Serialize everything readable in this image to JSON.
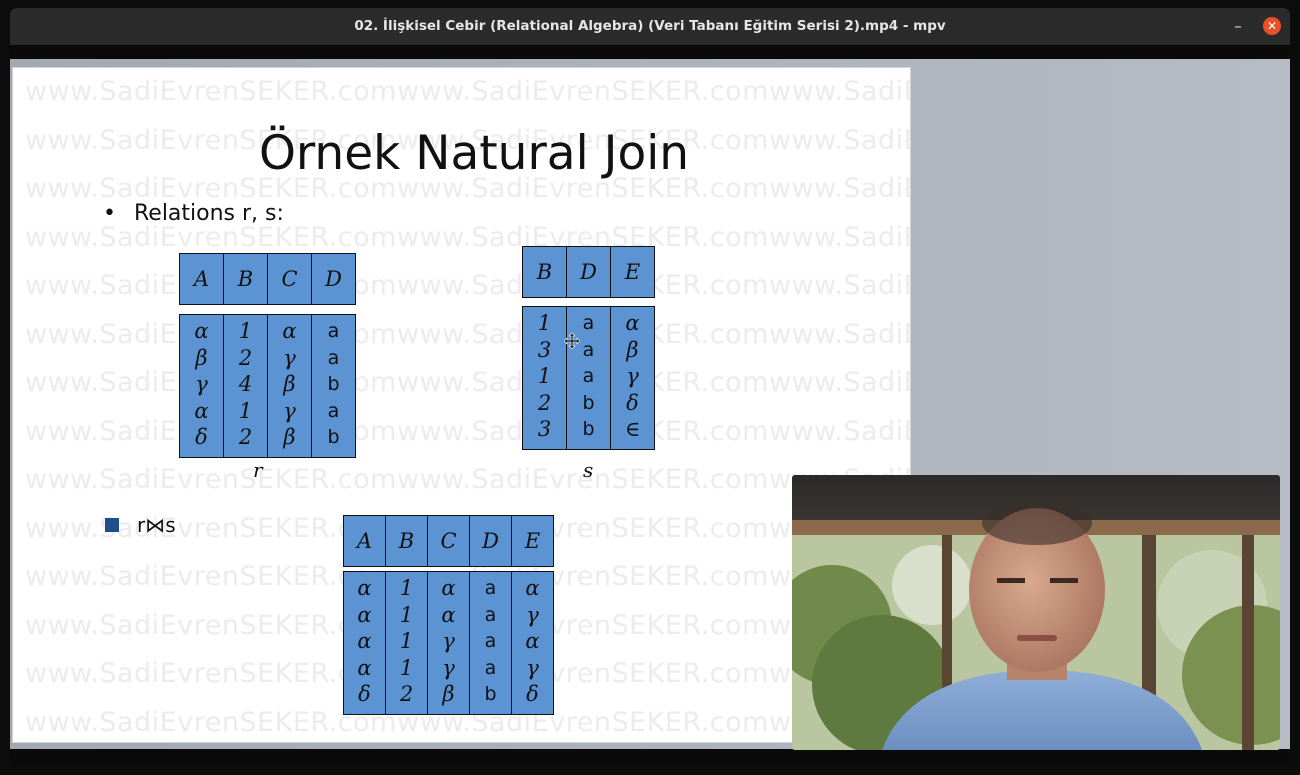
{
  "window": {
    "title": "02. İlişkisel Cebir (Relational Algebra) (Veri Tabanı Eğitim Serisi 2).mp4 - mpv",
    "minimize_glyph": "–",
    "close_glyph": "✕"
  },
  "slide": {
    "watermark": "www.SadiEvrenSEKER.com",
    "title": "Örnek Natural Join",
    "bullet_dot": "•",
    "bullet_text": "Relations r, s:",
    "expression": "r⋈s",
    "relation_r": {
      "label": "r",
      "columns": [
        "A",
        "B",
        "C",
        "D"
      ],
      "rows": [
        [
          "α",
          "1",
          "α",
          "a"
        ],
        [
          "β",
          "2",
          "γ",
          "a"
        ],
        [
          "γ",
          "4",
          "β",
          "b"
        ],
        [
          "α",
          "1",
          "γ",
          "a"
        ],
        [
          "δ",
          "2",
          "β",
          "b"
        ]
      ]
    },
    "relation_s": {
      "label": "s",
      "columns": [
        "B",
        "D",
        "E"
      ],
      "rows": [
        [
          "1",
          "a",
          "α"
        ],
        [
          "3",
          "a",
          "β"
        ],
        [
          "1",
          "a",
          "γ"
        ],
        [
          "2",
          "b",
          "δ"
        ],
        [
          "3",
          "b",
          "∈"
        ]
      ]
    },
    "result": {
      "columns": [
        "A",
        "B",
        "C",
        "D",
        "E"
      ],
      "rows": [
        [
          "α",
          "1",
          "α",
          "a",
          "α"
        ],
        [
          "α",
          "1",
          "α",
          "a",
          "γ"
        ],
        [
          "α",
          "1",
          "γ",
          "a",
          "α"
        ],
        [
          "α",
          "1",
          "γ",
          "a",
          "γ"
        ],
        [
          "δ",
          "2",
          "β",
          "b",
          "δ"
        ]
      ]
    }
  },
  "colors": {
    "table_fill": "#5b93d3",
    "close_button": "#e8522a",
    "bullet_square": "#1f4e8c"
  }
}
